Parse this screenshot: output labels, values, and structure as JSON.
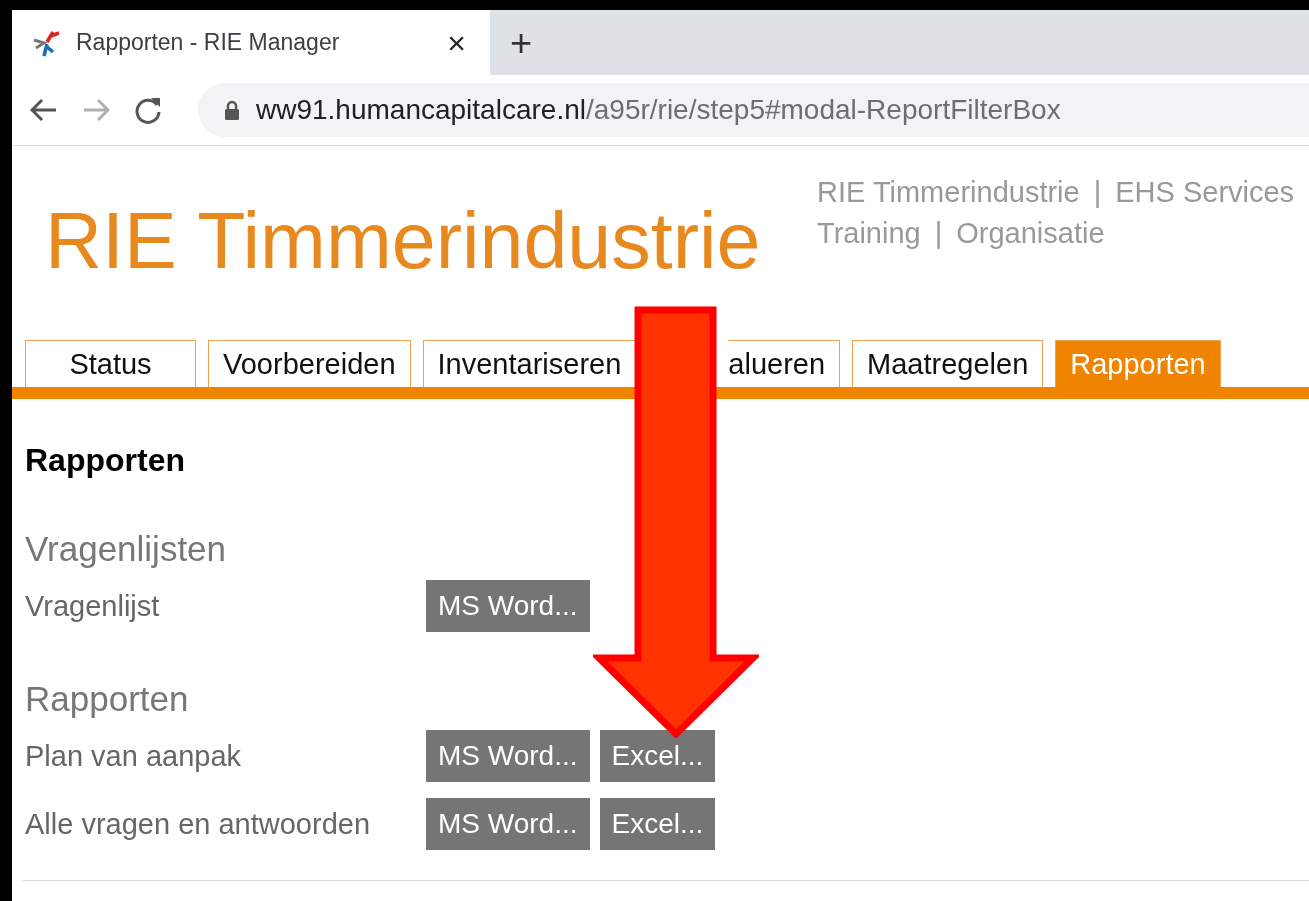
{
  "browser": {
    "tab_title": "Rapporten - RIE Manager",
    "close": "×",
    "new_tab": "+",
    "nav": [
      {
        "kind": "back",
        "disabled": false
      },
      {
        "kind": "forward",
        "disabled": true
      },
      {
        "kind": "reload",
        "disabled": false
      }
    ],
    "url": {
      "host": "ww91.humancapitalcare.nl",
      "path": "/a95r/rie/step5#modal-ReportFilterBox"
    }
  },
  "header": {
    "logo": "RIE Timmerindustrie",
    "link_lines": [
      [
        {
          "kind": "link",
          "text": "RIE Timmerindustrie"
        },
        {
          "kind": "separator",
          "text": "|"
        },
        {
          "kind": "link",
          "text": "EHS Services"
        }
      ],
      [
        {
          "kind": "link",
          "text": "Training"
        },
        {
          "kind": "separator",
          "text": "|"
        },
        {
          "kind": "link",
          "text": "Organisatie"
        }
      ]
    ]
  },
  "tabs": [
    {
      "label": "Status",
      "selected": false
    },
    {
      "label": "Voorbereiden",
      "selected": false
    },
    {
      "label": "Inventariseren",
      "selected": false
    },
    {
      "label": "alueren",
      "selected": false,
      "covered": true
    },
    {
      "label": "Maatregelen",
      "selected": false
    },
    {
      "label": "Rapporten",
      "selected": true
    }
  ],
  "heading": "Rapporten",
  "sections": [
    {
      "title": "Vragenlijsten",
      "rows": [
        {
          "label": "Vragenlijst",
          "buttons": [
            "MS Word..."
          ]
        }
      ]
    },
    {
      "title": "Rapporten",
      "rows": [
        {
          "label": "Plan van aanpak",
          "buttons": [
            "MS Word...",
            "Excel..."
          ]
        },
        {
          "label": "Alle vragen en antwoorden",
          "buttons": [
            "MS Word...",
            "Excel..."
          ]
        }
      ]
    }
  ]
}
